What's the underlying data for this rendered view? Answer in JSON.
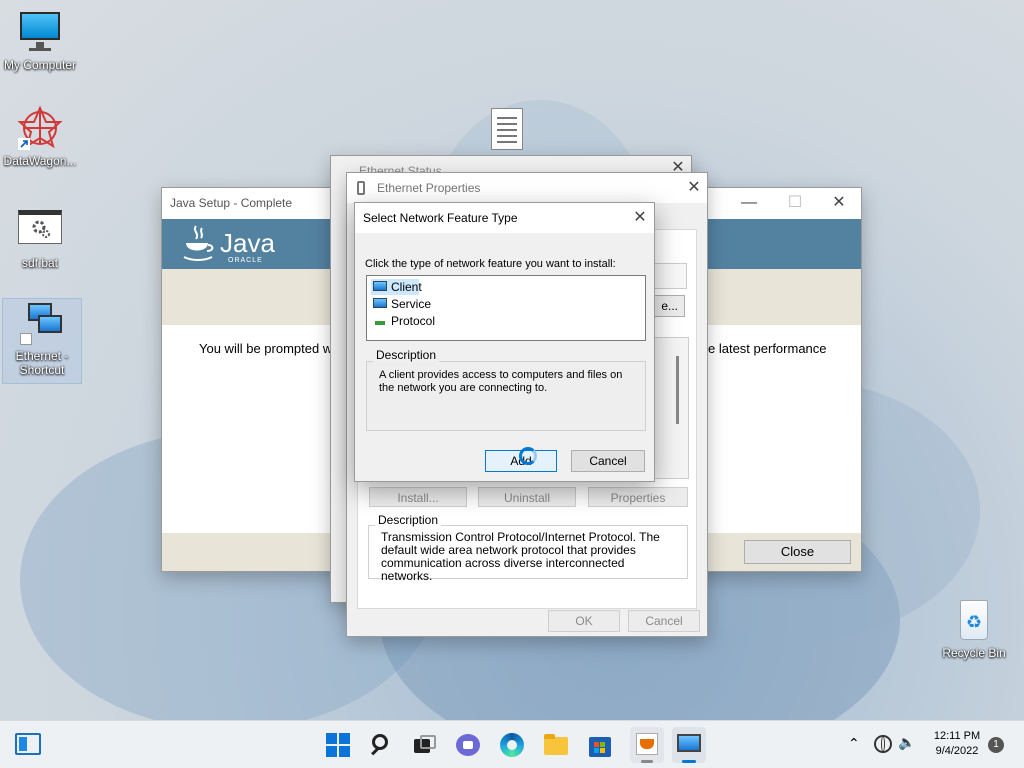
{
  "desktop": {
    "icons": [
      {
        "label": "My Computer"
      },
      {
        "label": "DataWagon..."
      },
      {
        "label": "sdf.bat"
      },
      {
        "label": "Ethernet - Shortcut"
      },
      {
        "label": "Recycle Bin"
      }
    ]
  },
  "java_window": {
    "title": "Java Setup - Complete",
    "logo_text": "Java",
    "logo_sub": "ORACLE",
    "message_left": "You will be prompted w",
    "message_right": "e latest performance",
    "close_label": "Close"
  },
  "ethernet_status": {
    "title": "Ethernet Status"
  },
  "ethernet_properties": {
    "title": "Ethernet Properties",
    "configure_fragment": "e...",
    "install_label": "Install...",
    "uninstall_label": "Uninstall",
    "properties_label": "Properties",
    "description_label": "Description",
    "description_text": "Transmission Control Protocol/Internet Protocol. The default wide area network protocol that provides communication across diverse interconnected networks.",
    "ok_label": "OK",
    "cancel_label": "Cancel"
  },
  "feature_dialog": {
    "title": "Select Network Feature Type",
    "prompt": "Click the type of network feature you want to install:",
    "items": [
      {
        "label": "Client",
        "selected": true
      },
      {
        "label": "Service",
        "selected": false
      },
      {
        "label": "Protocol",
        "selected": false
      }
    ],
    "description_label": "Description",
    "description_text": "A client provides access to computers and files on the network you are connecting to.",
    "add_label": "Add",
    "cancel_label": "Cancel"
  },
  "taskbar": {
    "time": "12:11 PM",
    "date": "9/4/2022",
    "notification_count": "1"
  },
  "colors": {
    "java_banner": "#5382a1",
    "accent": "#0078d4",
    "list_selected": "#cce8ff"
  }
}
